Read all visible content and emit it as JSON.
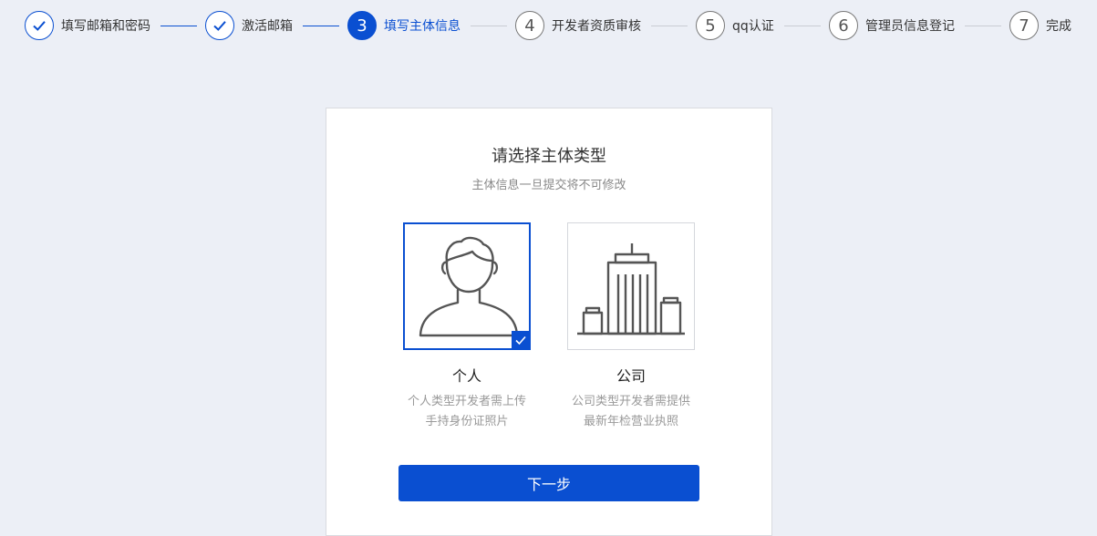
{
  "steps": [
    {
      "number": "1",
      "label": "填写邮箱和密码",
      "status": "done"
    },
    {
      "number": "2",
      "label": "激活邮箱",
      "status": "done"
    },
    {
      "number": "3",
      "label": "填写主体信息",
      "status": "active"
    },
    {
      "number": "4",
      "label": "开发者资质审核",
      "status": "pending"
    },
    {
      "number": "5",
      "label": "qq认证",
      "status": "pending"
    },
    {
      "number": "6",
      "label": "管理员信息登记",
      "status": "pending"
    },
    {
      "number": "7",
      "label": "完成",
      "status": "pending"
    }
  ],
  "card": {
    "title": "请选择主体类型",
    "subtitle": "主体信息一旦提交将不可修改",
    "options": [
      {
        "name": "个人",
        "desc_line1": "个人类型开发者需上传",
        "desc_line2": "手持身份证照片",
        "icon": "person-icon",
        "selected": true
      },
      {
        "name": "公司",
        "desc_line1": "公司类型开发者需提供",
        "desc_line2": "最新年检营业执照",
        "icon": "building-icon",
        "selected": false
      }
    ],
    "next_label": "下一步"
  },
  "colors": {
    "accent": "#0a4fd1",
    "background": "#eceff6"
  }
}
